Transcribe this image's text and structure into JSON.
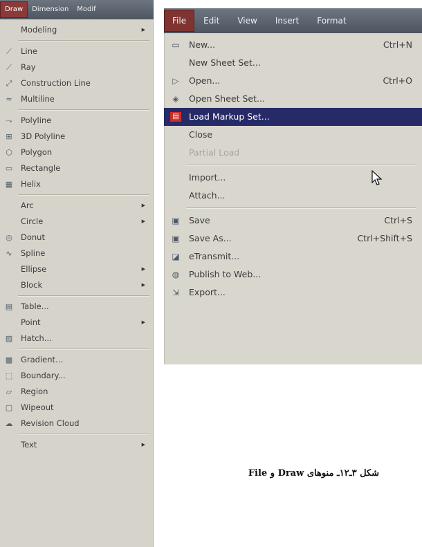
{
  "draw_menu": {
    "menubar": [
      "Draw",
      "Dimension",
      "Modif"
    ],
    "items": [
      {
        "label": "Modeling",
        "icon": "none",
        "submenu": true
      },
      {
        "sep": true
      },
      {
        "label": "Line",
        "icon": "line-icon"
      },
      {
        "label": "Ray",
        "icon": "ray-icon"
      },
      {
        "label": "Construction Line",
        "icon": "construction-line-icon"
      },
      {
        "label": "Multiline",
        "icon": "multiline-icon"
      },
      {
        "sep": true
      },
      {
        "label": "Polyline",
        "icon": "polyline-icon"
      },
      {
        "label": "3D Polyline",
        "icon": "3d-polyline-icon"
      },
      {
        "label": "Polygon",
        "icon": "polygon-icon"
      },
      {
        "label": "Rectangle",
        "icon": "rectangle-icon"
      },
      {
        "label": "Helix",
        "icon": "helix-icon"
      },
      {
        "sep": true
      },
      {
        "label": "Arc",
        "icon": "none",
        "submenu": true
      },
      {
        "label": "Circle",
        "icon": "none",
        "submenu": true
      },
      {
        "label": "Donut",
        "icon": "donut-icon"
      },
      {
        "label": "Spline",
        "icon": "spline-icon"
      },
      {
        "label": "Ellipse",
        "icon": "none",
        "submenu": true
      },
      {
        "label": "Block",
        "icon": "none",
        "submenu": true
      },
      {
        "sep": true
      },
      {
        "label": "Table...",
        "icon": "table-icon"
      },
      {
        "label": "Point",
        "icon": "none",
        "submenu": true
      },
      {
        "label": "Hatch...",
        "icon": "hatch-icon"
      },
      {
        "sep": true
      },
      {
        "label": "Gradient...",
        "icon": "gradient-icon"
      },
      {
        "label": "Boundary...",
        "icon": "boundary-icon"
      },
      {
        "label": "Region",
        "icon": "region-icon"
      },
      {
        "label": "Wipeout",
        "icon": "wipeout-icon"
      },
      {
        "label": "Revision Cloud",
        "icon": "revision-cloud-icon"
      },
      {
        "sep": true
      },
      {
        "label": "Text",
        "icon": "none",
        "submenu": true
      }
    ]
  },
  "file_menu": {
    "menubar": [
      "File",
      "Edit",
      "View",
      "Insert",
      "Format"
    ],
    "items": [
      {
        "label": "New...",
        "shortcut": "Ctrl+N",
        "icon": "new-icon"
      },
      {
        "label": "New Sheet Set...",
        "shortcut": "",
        "icon": "none"
      },
      {
        "label": "Open...",
        "shortcut": "Ctrl+O",
        "icon": "open-icon"
      },
      {
        "label": "Open Sheet Set...",
        "shortcut": "",
        "icon": "open-sheet-set-icon"
      },
      {
        "label": "Load Markup Set...",
        "shortcut": "",
        "icon": "markup-icon",
        "highlight": true
      },
      {
        "label": "Close",
        "shortcut": "",
        "icon": "none"
      },
      {
        "label": "Partial Load",
        "shortcut": "",
        "icon": "none",
        "disabled": true
      },
      {
        "sep": true
      },
      {
        "label": "Import...",
        "shortcut": "",
        "icon": "none"
      },
      {
        "label": "Attach...",
        "shortcut": "",
        "icon": "none"
      },
      {
        "sep": true
      },
      {
        "label": "Save",
        "shortcut": "Ctrl+S",
        "icon": "save-icon"
      },
      {
        "label": "Save As...",
        "shortcut": "Ctrl+Shift+S",
        "icon": "save-as-icon"
      },
      {
        "label": "eTransmit...",
        "shortcut": "",
        "icon": "etransmit-icon"
      },
      {
        "label": "Publish to Web...",
        "shortcut": "",
        "icon": "publish-icon"
      },
      {
        "label": "Export...",
        "shortcut": "",
        "icon": "export-icon"
      }
    ]
  },
  "caption": "شکل ۳ـ۱۲ـ منوهای Draw و File",
  "colors": {
    "menubar": "#5c6470",
    "panel_bg": "#d6d3cb",
    "highlight_bg": "#262a66",
    "active_menu": "#8b3a38"
  }
}
